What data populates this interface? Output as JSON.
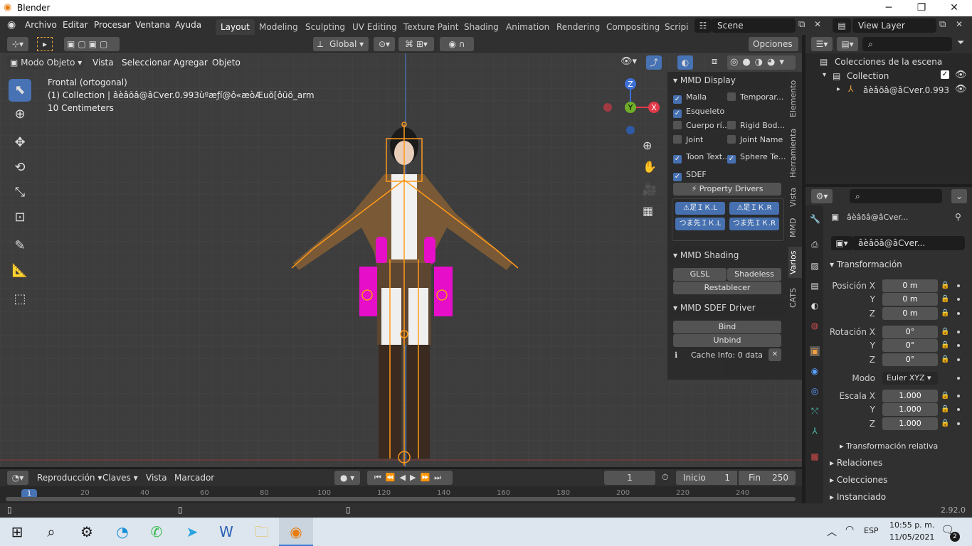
{
  "window": {
    "title": "Blender"
  },
  "menu": [
    "Archivo",
    "Editar",
    "Procesar",
    "Ventana",
    "Ayuda"
  ],
  "workspaces": [
    "Layout",
    "Modeling",
    "Sculpting",
    "UV Editing",
    "Texture Paint",
    "Shading",
    "Animation",
    "Rendering",
    "Compositing",
    "Scripi"
  ],
  "scene": {
    "name": "Scene",
    "view_layer": "View Layer",
    "opciones": "Opciones"
  },
  "viewport_header": {
    "transform": "Global",
    "mode": "Modo Objeto",
    "menus": [
      "Vista",
      "Seleccionar",
      "Agregar",
      "Objeto"
    ]
  },
  "viewport": {
    "view_name": "Frontal (ortogonal)",
    "collection_info": "(1) Collection | âèâõâ@âCver.0.993ùºæƒí@ô«æòÆuõ[ôüö_arm",
    "scale": "10 Centimeters",
    "gizmo": {
      "x": "X",
      "y": "Y",
      "z": "Z"
    }
  },
  "npanel": {
    "mmd_display": {
      "title": "MMD Display",
      "items": [
        {
          "label": "Malla",
          "checked": true
        },
        {
          "label": "Temporar...",
          "checked": false
        },
        {
          "label": "Esqueleto",
          "checked": true
        },
        {
          "label": "",
          "checked": false
        },
        {
          "label": "Cuerpo rí...",
          "checked": false
        },
        {
          "label": "Rigid Bod...",
          "checked": false
        },
        {
          "label": "Joint",
          "checked": false
        },
        {
          "label": "Joint Name",
          "checked": false
        },
        {
          "label": "Toon Text...",
          "checked": true
        },
        {
          "label": "Sphere Te...",
          "checked": true
        },
        {
          "label": "SDEF",
          "checked": true
        }
      ],
      "property_drivers": "Property Drivers",
      "ik_buttons": [
        "⚠足ＩＫ.L",
        "⚠足ＩＫ.R",
        "つま先ＩＫ.L",
        "つま先ＩＫ.R"
      ]
    },
    "mmd_shading": {
      "title": "MMD Shading",
      "glsl": "GLSL",
      "shadeless": "Shadeless",
      "reset": "Restablecer"
    },
    "mmd_sdef": {
      "title": "MMD SDEF Driver",
      "bind": "Bind",
      "unbind": "Unbind",
      "cache": "Cache Info: 0 data"
    },
    "tabs": [
      "Elemento",
      "Herramienta",
      "Vista",
      "MMD",
      "Varios",
      "CATS"
    ]
  },
  "outliner": {
    "root": "Colecciones de la escena",
    "collection": "Collection",
    "object": "âèâõâ@âCver.0.993"
  },
  "properties": {
    "object_name_top": "âèâõâ@âCver...",
    "object_name": "âèâõâ@âCver...",
    "transform_title": "Transformación",
    "pos_label": "Posición X",
    "rot_label": "Rotación X",
    "scale_label": "Escala X",
    "y": "Y",
    "z": "Z",
    "pos": [
      "0 m",
      "0 m",
      "0 m"
    ],
    "rot": [
      "0°",
      "0°",
      "0°"
    ],
    "mode_label": "Modo",
    "mode": "Euler XYZ",
    "scale": [
      "1.000",
      "1.000",
      "1.000"
    ],
    "relative": "Transformación relativa",
    "sections": [
      "Relaciones",
      "Colecciones",
      "Instanciado"
    ]
  },
  "timeline": {
    "playback": "Reproducción",
    "keys": "Claves",
    "view": "Vista",
    "marker": "Marcador",
    "frame": "1",
    "start_label": "Inicio",
    "start": "1",
    "end_label": "Fin",
    "end": "250",
    "ticks": [
      "1",
      "20",
      "40",
      "60",
      "80",
      "100",
      "120",
      "140",
      "160",
      "180",
      "200",
      "220",
      "240"
    ]
  },
  "status": {
    "version": "2.92.0"
  },
  "taskbar": {
    "lang": "ESP",
    "time": "10:55 p. m.",
    "date": "11/05/2021",
    "notifications": "2"
  }
}
